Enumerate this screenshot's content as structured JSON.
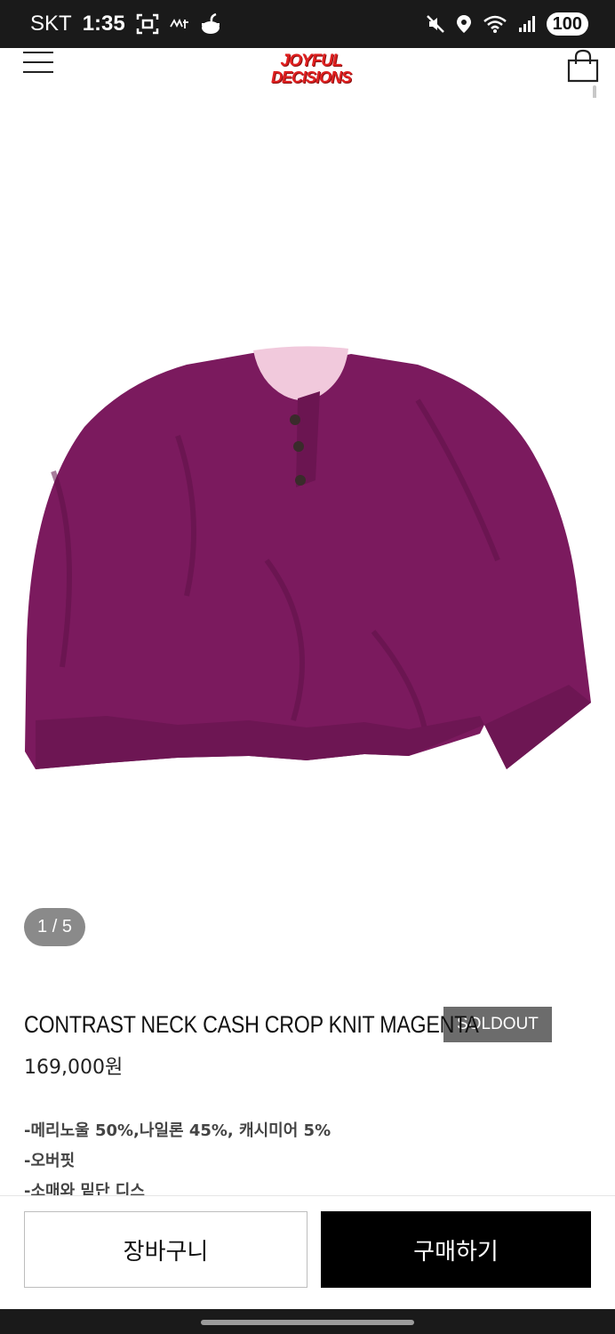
{
  "status_bar": {
    "carrier": "SKT",
    "time": "1:35",
    "battery": "100",
    "left_icons": [
      "screenshot-icon",
      "notification-icon",
      "cup-icon"
    ],
    "right_icons": [
      "mute-icon",
      "location-icon",
      "wifi-icon",
      "signal-icon"
    ]
  },
  "header": {
    "logo_line1": "JOYFUL",
    "logo_line2": "DECISIONS",
    "brand_color": "#e02020"
  },
  "gallery": {
    "counter": "1 / 5",
    "product_color": "#7b1a5e",
    "collar_color": "#f1c9dc"
  },
  "product": {
    "title": "CONTRAST NECK CASH CROP KNIT MAGENTA",
    "badge": "SOLDOUT",
    "price": "169,000원",
    "description": [
      "-메리노울 50%,나일론 45%, 캐시미어 5%",
      "-오버핏",
      "-소매와 밑단 디스"
    ]
  },
  "actions": {
    "cart_label": "장바구니",
    "buy_label": "구매하기"
  }
}
